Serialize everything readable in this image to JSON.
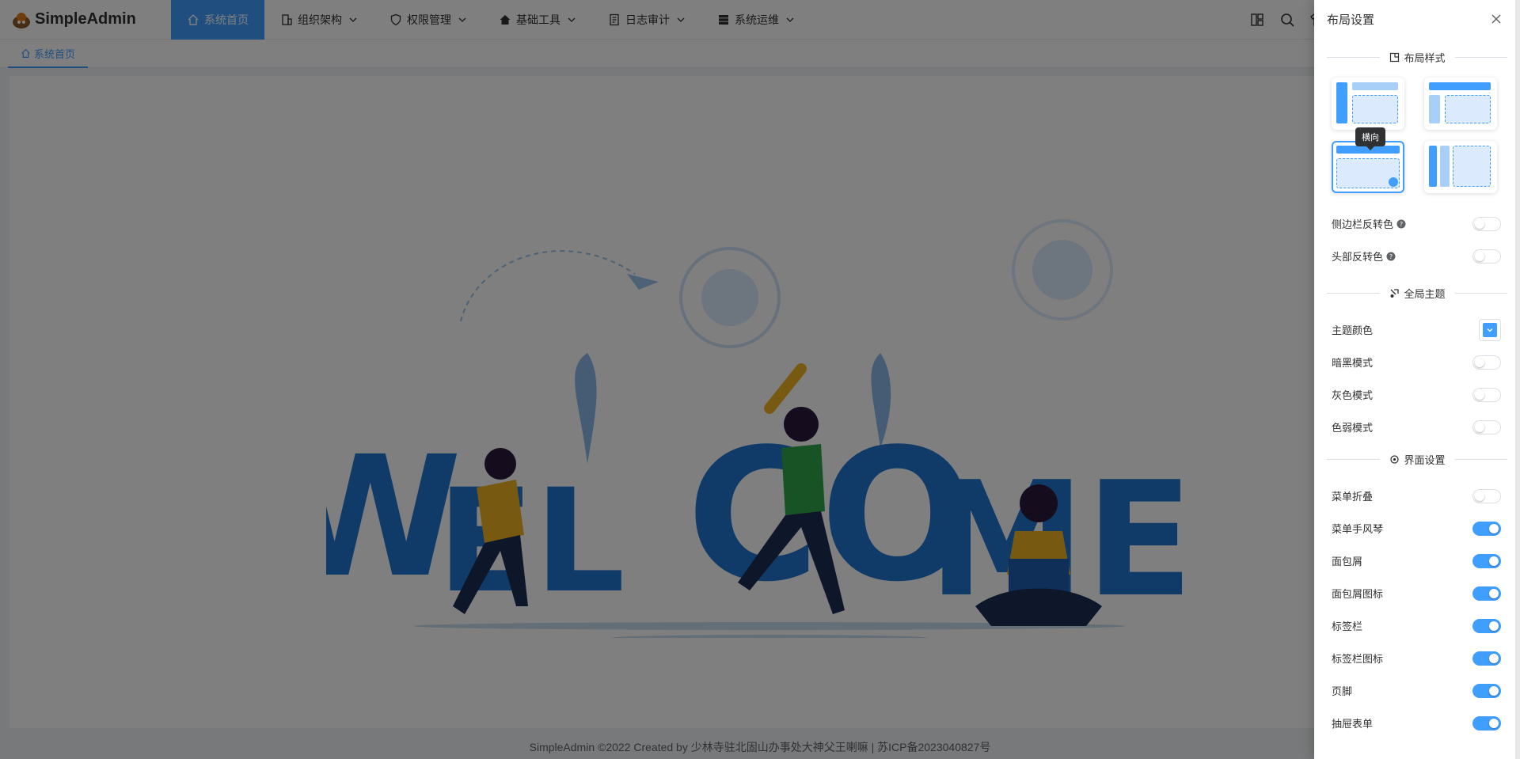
{
  "app": {
    "title": "SimpleAdmin"
  },
  "nav": [
    {
      "label": "系统首页",
      "active": true,
      "icon": "home-icon"
    },
    {
      "label": "组织架构",
      "icon": "building-icon"
    },
    {
      "label": "权限管理",
      "icon": "shield-icon"
    },
    {
      "label": "基础工具",
      "icon": "house-icon"
    },
    {
      "label": "日志审计",
      "icon": "document-icon"
    },
    {
      "label": "系统运维",
      "icon": "server-icon"
    }
  ],
  "tab": {
    "label": "系统首页"
  },
  "footer": {
    "text": "SimpleAdmin ©2022 Created by 少林寺驻北固山办事处大神父王喇嘛 | 苏ICP备2023040827号"
  },
  "drawer": {
    "title": "布局设置",
    "layout_section": "布局样式",
    "tooltip": "横向",
    "sidebar_invert": "侧边栏反转色",
    "header_invert": "头部反转色",
    "theme_section": "全局主题",
    "theme_color": "主题颜色",
    "dark_mode": "暗黑模式",
    "gray_mode": "灰色模式",
    "weak_mode": "色弱模式",
    "ui_section": "界面设置",
    "menu_collapse": "菜单折叠",
    "menu_accordion": "菜单手风琴",
    "breadcrumb": "面包屑",
    "breadcrumb_icon": "面包屑图标",
    "tabs": "标签栏",
    "tabs_icon": "标签栏图标",
    "footer": "页脚",
    "drawer_form": "抽屉表单"
  },
  "colors": {
    "accent": "#409eff"
  }
}
